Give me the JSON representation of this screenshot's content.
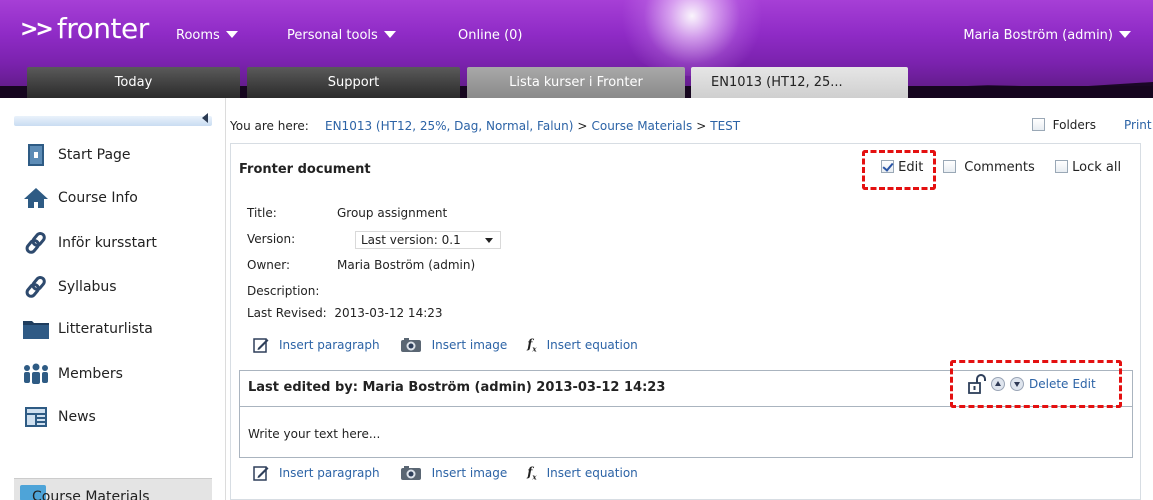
{
  "header": {
    "logo": "fronter",
    "logo_prefix": ">>",
    "nav": [
      "Rooms",
      "Personal tools",
      "Online (0)"
    ],
    "user": "Maria Boström (admin)"
  },
  "tabs": [
    "Today",
    "Support",
    "Lista kurser i Fronter",
    "EN1013 (HT12, 25..."
  ],
  "sidebar": {
    "items": [
      {
        "label": "Start Page",
        "icon": "start-page-icon"
      },
      {
        "label": "Course Info",
        "icon": "home-icon"
      },
      {
        "label": "Inför kursstart",
        "icon": "link-icon"
      },
      {
        "label": "Syllabus",
        "icon": "link-icon"
      },
      {
        "label": "Litteraturlista",
        "icon": "folder-icon"
      },
      {
        "label": "Members",
        "icon": "people-icon"
      },
      {
        "label": "News",
        "icon": "news-icon"
      }
    ],
    "current": "Course Materials"
  },
  "breadcrumb": {
    "lead": "You are here:",
    "items": [
      "EN1013 (HT12, 25%, Dag, Normal, Falun)",
      "Course Materials",
      "TEST"
    ],
    "separator": ">",
    "folders_label": "Folders",
    "print_label": "Print"
  },
  "document": {
    "heading": "Fronter document",
    "options": {
      "edit": "Edit",
      "comments": "Comments",
      "lock_all": "Lock all",
      "edit_checked": true
    },
    "fields": {
      "title_label": "Title:",
      "title_value": "Group assignment",
      "version_label": "Version:",
      "version_value": "Last version: 0.1",
      "owner_label": "Owner:",
      "owner_value": "Maria Boström (admin)",
      "description_label": "Description:",
      "revised_label": "Last Revised:",
      "revised_value": "2013-03-12 14:23"
    },
    "insert": {
      "paragraph": "Insert paragraph",
      "image": "Insert image",
      "equation": "Insert equation"
    },
    "paragraph": {
      "header": "Last edited by: Maria Boström (admin) 2013-03-12 14:23",
      "body": "Write your text here...",
      "delete": "Delete",
      "edit": "Edit"
    }
  },
  "colors": {
    "link": "#2c63a6",
    "header_purple": "#8f2bc6",
    "highlight": "#e41010"
  }
}
